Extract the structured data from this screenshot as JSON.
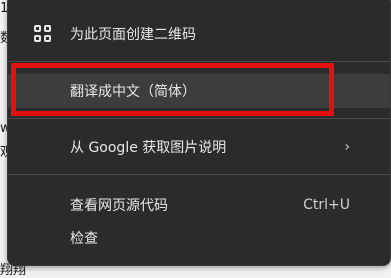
{
  "background_fragments": [
    "1",
    "数",
    "w",
    "观",
    "翔翔"
  ],
  "menu": {
    "items": [
      {
        "label": "为此页面创建二维码",
        "icon": "qr-code-icon"
      },
      {
        "label": "翻译成中文（简体）"
      },
      {
        "label": "从 Google 获取图片说明",
        "icon": "chevron-right-icon",
        "chevron": "›"
      },
      {
        "label": "查看网页源代码",
        "shortcut": "Ctrl+U"
      },
      {
        "label": "检查"
      }
    ]
  },
  "colors": {
    "menu_background": "#2b2b2b",
    "hover_background": "#3d3d3d",
    "highlight_border": "#e31010",
    "text": "#e8e8e8"
  }
}
